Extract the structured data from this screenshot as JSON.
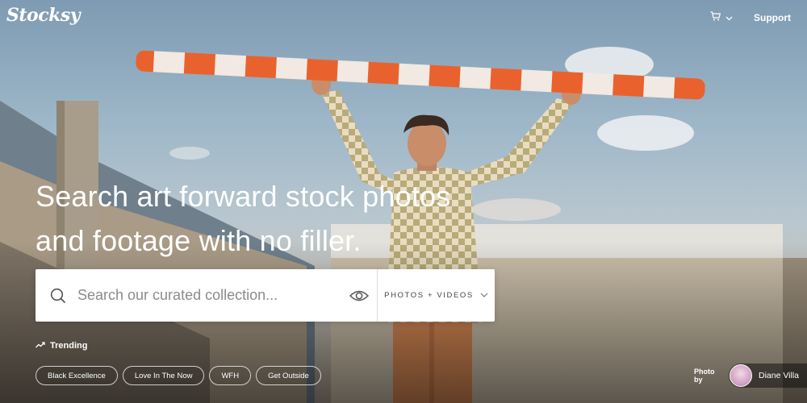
{
  "header": {
    "logo": "Stocksy",
    "support_label": "Support"
  },
  "hero": {
    "headline_line1": "Search art forward stock photos",
    "headline_line2": "and footage with no filler."
  },
  "search": {
    "placeholder": "Search our curated collection...",
    "value": "",
    "filter_label": "PHOTOS + VIDEOS"
  },
  "trending": {
    "label": "Trending",
    "chips": [
      "Black Excellence",
      "Love In The Now",
      "WFH",
      "Get Outside"
    ]
  },
  "credit": {
    "label": "Photo by",
    "name": "Diane Villa"
  },
  "icons": {
    "cart": "cart-icon",
    "chevron": "chevron-down-icon",
    "search": "search-icon",
    "eye": "eye-icon",
    "trending": "trending-up-icon"
  },
  "colors": {
    "pole_orange": "#e9622e",
    "pole_white": "#f1e9e2"
  }
}
